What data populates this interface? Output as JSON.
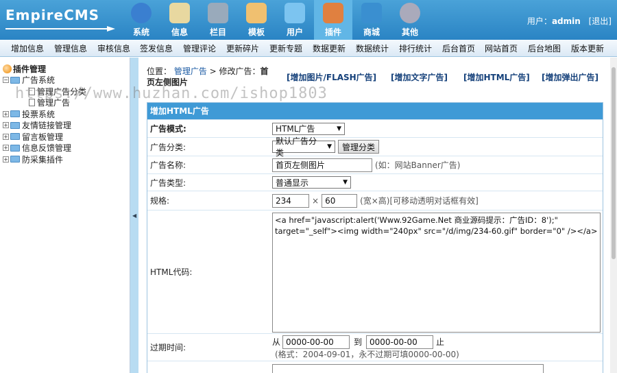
{
  "header": {
    "logo_text": "EmpireCMS",
    "user_label": "用户：",
    "user_name": "admin",
    "logout_label": "[退出]",
    "nav": [
      {
        "label": "系统",
        "icon": "globe-icon",
        "color": "#3a7fd0"
      },
      {
        "label": "信息",
        "icon": "document-icon",
        "color": "#e8d8a0"
      },
      {
        "label": "栏目",
        "icon": "folder-icon",
        "color": "#9ab"
      },
      {
        "label": "模板",
        "icon": "template-icon",
        "color": "#f0c070"
      },
      {
        "label": "用户",
        "icon": "user-icon",
        "color": "#7cc4f0"
      },
      {
        "label": "插件",
        "icon": "tools-icon",
        "color": "#e08040"
      },
      {
        "label": "商城",
        "icon": "card-icon",
        "color": "#3a8fd0"
      },
      {
        "label": "其他",
        "icon": "gear-icon",
        "color": "#aab"
      }
    ]
  },
  "submenu": [
    "增加信息",
    "管理信息",
    "审核信息",
    "签发信息",
    "管理评论",
    "更新碎片",
    "更新专题",
    "数据更新",
    "数据统计",
    "排行统计",
    "后台首页",
    "网站首页",
    "后台地图",
    "版本更新"
  ],
  "tree": {
    "root": "插件管理",
    "items": [
      {
        "label": "广告系统",
        "expanded": true
      },
      {
        "label": "管理广告分类",
        "child": true
      },
      {
        "label": "管理广告",
        "child": true
      },
      {
        "label": "投票系统"
      },
      {
        "label": "友情链接管理"
      },
      {
        "label": "留言板管理"
      },
      {
        "label": "信息反馈管理"
      },
      {
        "label": "防采集插件"
      }
    ]
  },
  "watermark": "https://www.huzhan.com/ishop1803",
  "breadcrumb": {
    "prefix": "位置：",
    "link": "管理广告",
    "sep": " > 修改广告：",
    "current": "首页左侧图片"
  },
  "actions": [
    "[增加图片/FLASH广告]",
    "[增加文字广告]",
    "[增加HTML广告]",
    "[增加弹出广告]"
  ],
  "form": {
    "title": "增加HTML广告",
    "mode_label": "广告模式:",
    "mode_value": "HTML广告",
    "category_label": "广告分类:",
    "category_value": "默认广告分类",
    "category_button": "管理分类",
    "name_label": "广告名称:",
    "name_value": "首页左侧图片",
    "name_hint": "(如：网站Banner广告)",
    "type_label": "广告类型:",
    "type_value": "普通显示",
    "size_label": "规格:",
    "width_value": "234",
    "times": "×",
    "height_value": "60",
    "size_hint": "(宽×高)[可移动透明对话框有效]",
    "html_label": "HTML代码:",
    "html_code": "<a href=\"javascript:alert('Www.92Game.Net 商业源码提示：广告ID：8');\" target=\"_self\"><img width=\"240px\" src=\"/d/img/234-60.gif\" border=\"0\" /></a>",
    "expire_label": "过期时间:",
    "from": "从",
    "start_date": "0000-00-00",
    "to": "到",
    "end_date": "0000-00-00",
    "stop": "止",
    "expire_hint": "(格式：2004-09-01，永不过期可填0000-00-00)"
  }
}
